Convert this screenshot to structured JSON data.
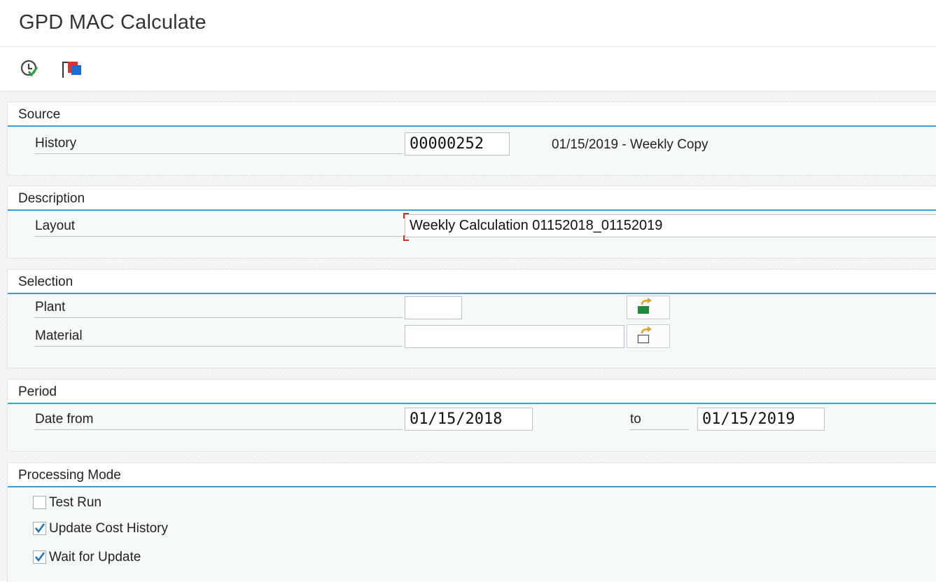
{
  "app": {
    "title": "GPD MAC Calculate"
  },
  "toolbar": {
    "execute_icon": "clock-check-icon",
    "variant_icon": "copy-variant-icon"
  },
  "source": {
    "group_title": "Source",
    "history_label": "History",
    "history_value": "00000252",
    "history_desc": "01/15/2019 - Weekly Copy"
  },
  "description": {
    "group_title": "Description",
    "layout_label": "Layout",
    "layout_value": "Weekly Calculation 01152018_01152019"
  },
  "selection": {
    "group_title": "Selection",
    "plant_label": "Plant",
    "plant_value": "",
    "material_label": "Material",
    "material_value": ""
  },
  "period": {
    "group_title": "Period",
    "date_from_label": "Date from",
    "date_from_value": "01/15/2018",
    "to_label": "to",
    "date_to_value": "01/15/2019"
  },
  "processing": {
    "group_title": "Processing Mode",
    "options": [
      {
        "label": "Test Run",
        "checked": false
      },
      {
        "label": "Update Cost History",
        "checked": true
      },
      {
        "label": "Wait for Update",
        "checked": true
      }
    ]
  },
  "colors": {
    "accent_blue": "#3a9fd1",
    "check_blue": "#1a73c8"
  }
}
